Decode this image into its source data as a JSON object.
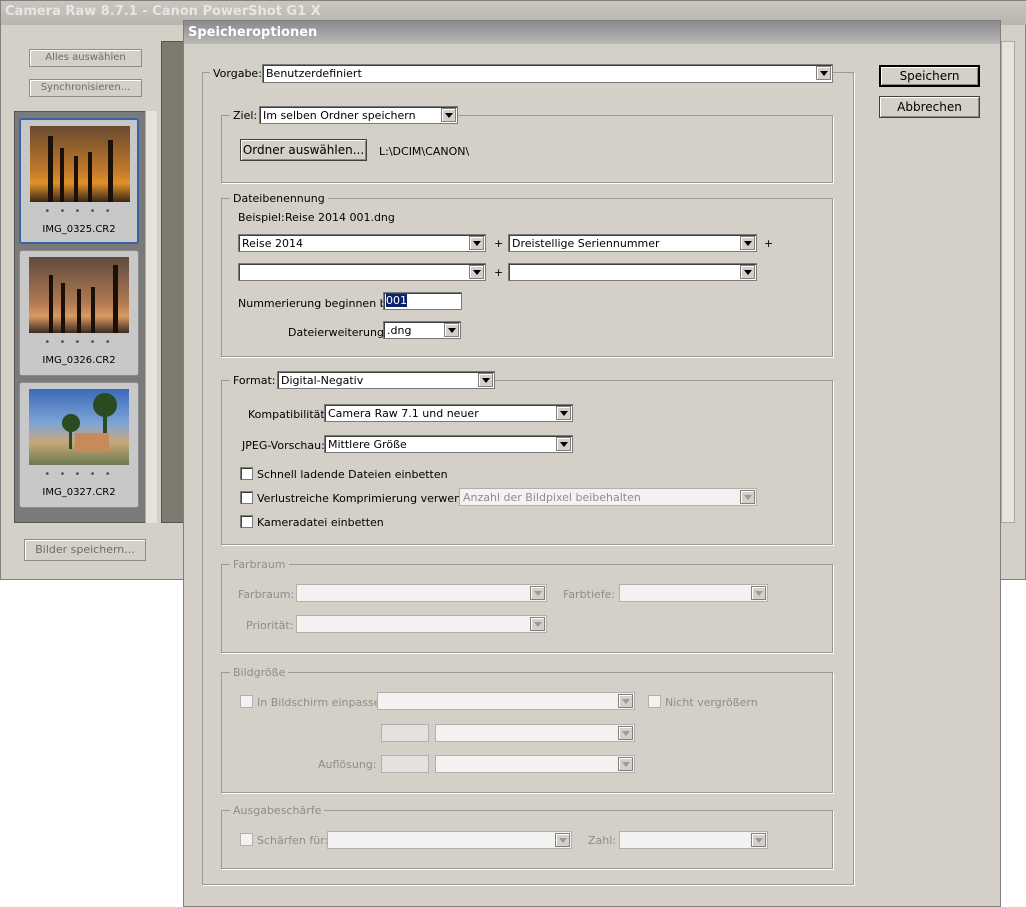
{
  "bg": {
    "title": "Camera Raw 8.7.1  -  Canon PowerShot G1 X",
    "select_all": "Alles auswählen",
    "synchronize": "Synchronisieren...",
    "save_images": "Bilder speichern...",
    "thumbs": [
      {
        "caption": "IMG_0325.CR2",
        "stars": "• • • • •"
      },
      {
        "caption": "IMG_0326.CR2",
        "stars": "• • • • •"
      },
      {
        "caption": "IMG_0327.CR2",
        "stars": "• • • • •"
      }
    ]
  },
  "dialog": {
    "title": "Speicheroptionen",
    "preset_label": "Vorgabe:",
    "preset_value": "Benutzerdefiniert",
    "save_button": "Speichern",
    "cancel_button": "Abbrechen",
    "target": {
      "label": "Ziel:",
      "value": "Im selben Ordner speichern",
      "choose_folder": "Ordner auswählen...",
      "path": "L:\\DCIM\\CANON\\"
    },
    "naming": {
      "legend": "Dateibenennung",
      "example_label": "Beispiel:",
      "example_value": "Reise 2014 001.dng",
      "field1": "Reise 2014",
      "field2": "Dreistellige Seriennummer",
      "field3": "",
      "field4": "",
      "plus": "+",
      "start_label": "Nummerierung beginnen bei:",
      "start_value": "001",
      "ext_label": "Dateierweiterung:",
      "ext_value": ".dng"
    },
    "format": {
      "label": "Format:",
      "value": "Digital-Negativ",
      "compat_label": "Kompatibilität:",
      "compat_value": "Camera Raw 7.1 und neuer",
      "jpeg_label": "JPEG-Vorschau:",
      "jpeg_value": "Mittlere Größe",
      "fast_load": "Schnell ladende Dateien einbetten",
      "lossy": "Verlustreiche Komprimierung verwenden:",
      "lossy_value": "Anzahl der Bildpixel beibehalten",
      "embed_raw": "Kameradatei einbetten"
    },
    "colorspace": {
      "legend": "Farbraum",
      "space_label": "Farbraum:",
      "depth_label": "Farbtiefe:",
      "priority_label": "Priorität:"
    },
    "imagesize": {
      "legend": "Bildgröße",
      "fit_label": "In Bildschirm einpassen:",
      "no_enlarge": "Nicht vergrößern",
      "resolution_label": "Auflösung:"
    },
    "sharpen": {
      "legend": "Ausgabeschärfe",
      "for_label": "Schärfen für:",
      "amount_label": "Zahl:"
    }
  }
}
